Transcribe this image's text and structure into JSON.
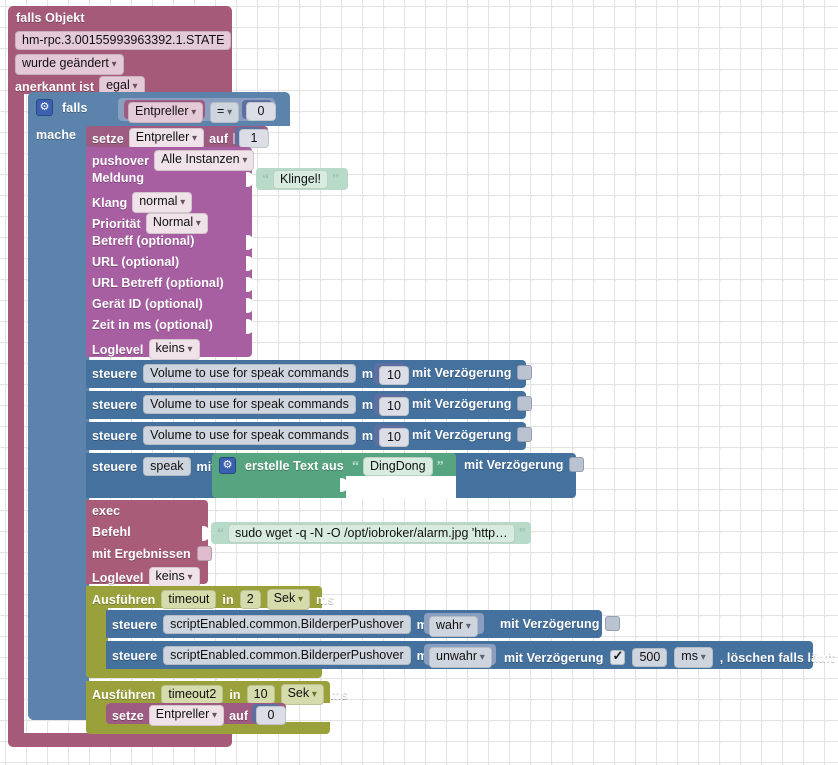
{
  "workspace": {
    "background": "#ffffff",
    "grid_color": "#e6e6e6"
  },
  "trigger": {
    "title": "falls Objekt",
    "object_id": "hm-rpc.3.00155993963392.1.STATE",
    "condition": "wurde geändert",
    "ack_label": "anerkannt ist",
    "ack_value": "egal"
  },
  "if_block": {
    "label": "falls",
    "do_label": "mache",
    "var_name": "Entpreller",
    "operator": "=",
    "compare_value": "0"
  },
  "set_var_top": {
    "label": "setze",
    "var_name": "Entpreller",
    "to_label": "auf",
    "value": "1"
  },
  "pushover": {
    "title": "pushover",
    "instance": "Alle Instanzen",
    "rows": [
      {
        "label": "Meldung",
        "kind": "text",
        "value": "Klingel!"
      },
      {
        "label": "Klang",
        "kind": "dropdown",
        "value": "normal"
      },
      {
        "label": "Priorität",
        "kind": "dropdown",
        "value": "Normal"
      },
      {
        "label": "Betreff (optional)",
        "kind": "socket",
        "value": ""
      },
      {
        "label": "URL (optional)",
        "kind": "socket",
        "value": ""
      },
      {
        "label": "URL Betreff (optional)",
        "kind": "socket",
        "value": ""
      },
      {
        "label": "Gerät ID (optional)",
        "kind": "socket",
        "value": ""
      },
      {
        "label": "Zeit in ms (optional)",
        "kind": "socket",
        "value": ""
      },
      {
        "label": "Loglevel",
        "kind": "dropdown",
        "value": "keins"
      }
    ]
  },
  "control_rows": [
    {
      "verb": "steuere",
      "target": "Volume to use for speak commands",
      "with_label": "mit",
      "value": "10",
      "delay_label": "mit Verzögerung",
      "delay_checked": false
    },
    {
      "verb": "steuere",
      "target": "Volume to use for speak commands",
      "with_label": "mit",
      "value": "10",
      "delay_label": "mit Verzögerung",
      "delay_checked": false
    },
    {
      "verb": "steuere",
      "target": "Volume to use for speak commands",
      "with_label": "mit",
      "value": "10",
      "delay_label": "mit Verzögerung",
      "delay_checked": false
    }
  ],
  "speak_row": {
    "verb": "steuere",
    "target": "speak",
    "with_label": "mit",
    "join_label": "erstelle Text aus",
    "join_value": "DingDong",
    "delay_label": "mit Verzögerung",
    "delay_checked": false
  },
  "exec": {
    "title": "exec",
    "command_label": "Befehl",
    "command_value": "sudo wget -q -N -O /opt/iobroker/alarm.jpg 'http…",
    "results_label": "mit Ergebnissen",
    "results_checked": false,
    "loglevel_label": "Loglevel",
    "loglevel_value": "keins"
  },
  "timeout1": {
    "run_label": "Ausführen",
    "name": "timeout",
    "in_label": "in",
    "amount": "2",
    "unit": "Sek",
    "unit_suffix": "ms",
    "rows": [
      {
        "verb": "steuere",
        "target": "scriptEnabled.common.BilderperPushover",
        "with_label": "mit",
        "value": "wahr",
        "delay_label": "mit Verzögerung",
        "delay_checked": false,
        "delay_amount": "",
        "delay_unit": "",
        "clear_label": "",
        "clear_checked": false
      },
      {
        "verb": "steuere",
        "target": "scriptEnabled.common.BilderperPushover",
        "with_label": "mit",
        "value": "unwahr",
        "delay_label": "mit Verzögerung",
        "delay_checked": true,
        "delay_amount": "500",
        "delay_unit": "ms",
        "clear_label": ", löschen falls läuft",
        "clear_checked": false
      }
    ]
  },
  "timeout2": {
    "run_label": "Ausführen",
    "name": "timeout2",
    "in_label": "in",
    "amount": "10",
    "unit": "Sek",
    "unit_suffix": "ms",
    "set_var": {
      "label": "setze",
      "var_name": "Entpreller",
      "to_label": "auf",
      "value": "0"
    }
  }
}
